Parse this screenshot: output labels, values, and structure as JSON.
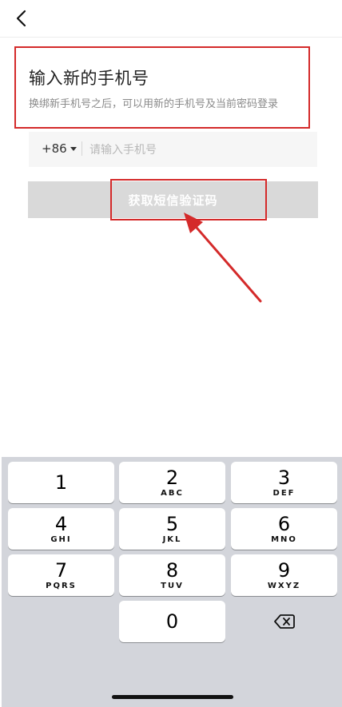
{
  "header": {
    "back_icon": "chevron-left-icon"
  },
  "page": {
    "title": "输入新的手机号",
    "subtitle": "换绑新手机号之后，可以用新的手机号及当前密码登录"
  },
  "phone": {
    "country_code": "+86",
    "value": "",
    "placeholder": "请输入手机号"
  },
  "sms_button": {
    "label": "获取短信验证码",
    "state": "disabled"
  },
  "colors": {
    "annotation": "#d42a2a",
    "button_disabled": "#d9d9d9",
    "keyboard_bg": "#d3d5db"
  },
  "keypad": {
    "keys": [
      {
        "num": "1",
        "letters": ""
      },
      {
        "num": "2",
        "letters": "ABC"
      },
      {
        "num": "3",
        "letters": "DEF"
      },
      {
        "num": "4",
        "letters": "GHI"
      },
      {
        "num": "5",
        "letters": "JKL"
      },
      {
        "num": "6",
        "letters": "MNO"
      },
      {
        "num": "7",
        "letters": "PQRS"
      },
      {
        "num": "8",
        "letters": "TUV"
      },
      {
        "num": "9",
        "letters": "WXYZ"
      },
      {
        "num": "0",
        "letters": ""
      }
    ],
    "delete_icon": "backspace-icon"
  }
}
